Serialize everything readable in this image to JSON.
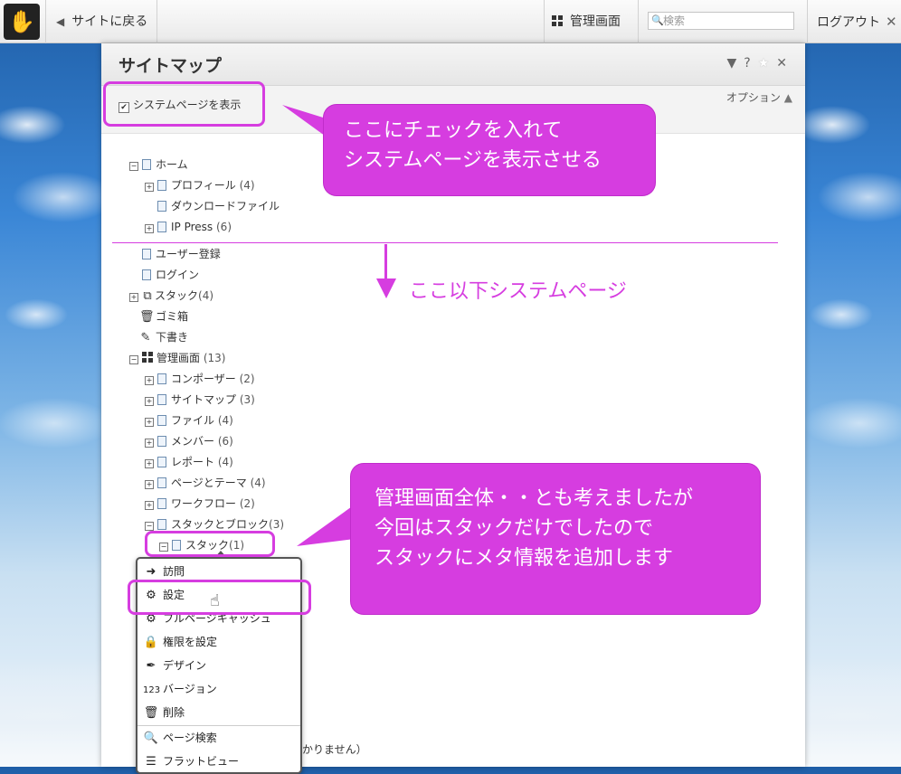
{
  "topbar": {
    "back_label": "サイトに戻る",
    "dashboard_label": "管理画面",
    "search_placeholder": "検索",
    "logout_label": "ログアウト"
  },
  "panel": {
    "title": "サイトマップ",
    "show_system_label": "システムページを表示",
    "options_label": "オプション"
  },
  "tree": [
    {
      "label": "ホーム",
      "count": ""
    },
    {
      "label": "プロフィール",
      "count": "(4)"
    },
    {
      "label": "ダウンロードファイル",
      "count": ""
    },
    {
      "label": "IP Press",
      "count": "(6)"
    },
    {
      "label": "ユーザー登録",
      "count": ""
    },
    {
      "label": "ログイン",
      "count": ""
    },
    {
      "label": "スタック",
      "count": "(4)"
    },
    {
      "label": "ゴミ箱",
      "count": ""
    },
    {
      "label": "下書き",
      "count": ""
    },
    {
      "label": "管理画面",
      "count": "(13)"
    },
    {
      "label": "コンポーザー",
      "count": "(2)"
    },
    {
      "label": "サイトマップ",
      "count": "(3)"
    },
    {
      "label": "ファイル",
      "count": "(4)"
    },
    {
      "label": "メンバー",
      "count": "(6)"
    },
    {
      "label": "レポート",
      "count": "(4)"
    },
    {
      "label": "ページとテーマ",
      "count": "(4)"
    },
    {
      "label": "ワークフロー",
      "count": "(2)"
    },
    {
      "label": "スタックとブロック",
      "count": "(3)"
    },
    {
      "label": "スタック",
      "count": "(1)"
    }
  ],
  "context_menu": [
    "訪問",
    "設定",
    "フルページキャッシュ",
    "権限を設定",
    "デザイン",
    "バージョン",
    "削除",
    "ページ検索",
    "フラットビュー"
  ],
  "hidden_text": "つかりません）",
  "annotations": {
    "callout_1_line1": "ここにチェックを入れて",
    "callout_1_line2": "システムページを表示させる",
    "system_pages_label": "ここ以下システムページ",
    "callout_2_line1": "管理画面全体・・とも考えましたが",
    "callout_2_line2": "今回はスタックだけでしたので",
    "callout_2_line3": "スタックにメタ情報を追加します"
  },
  "colors": {
    "annotation": "#d63de0"
  }
}
